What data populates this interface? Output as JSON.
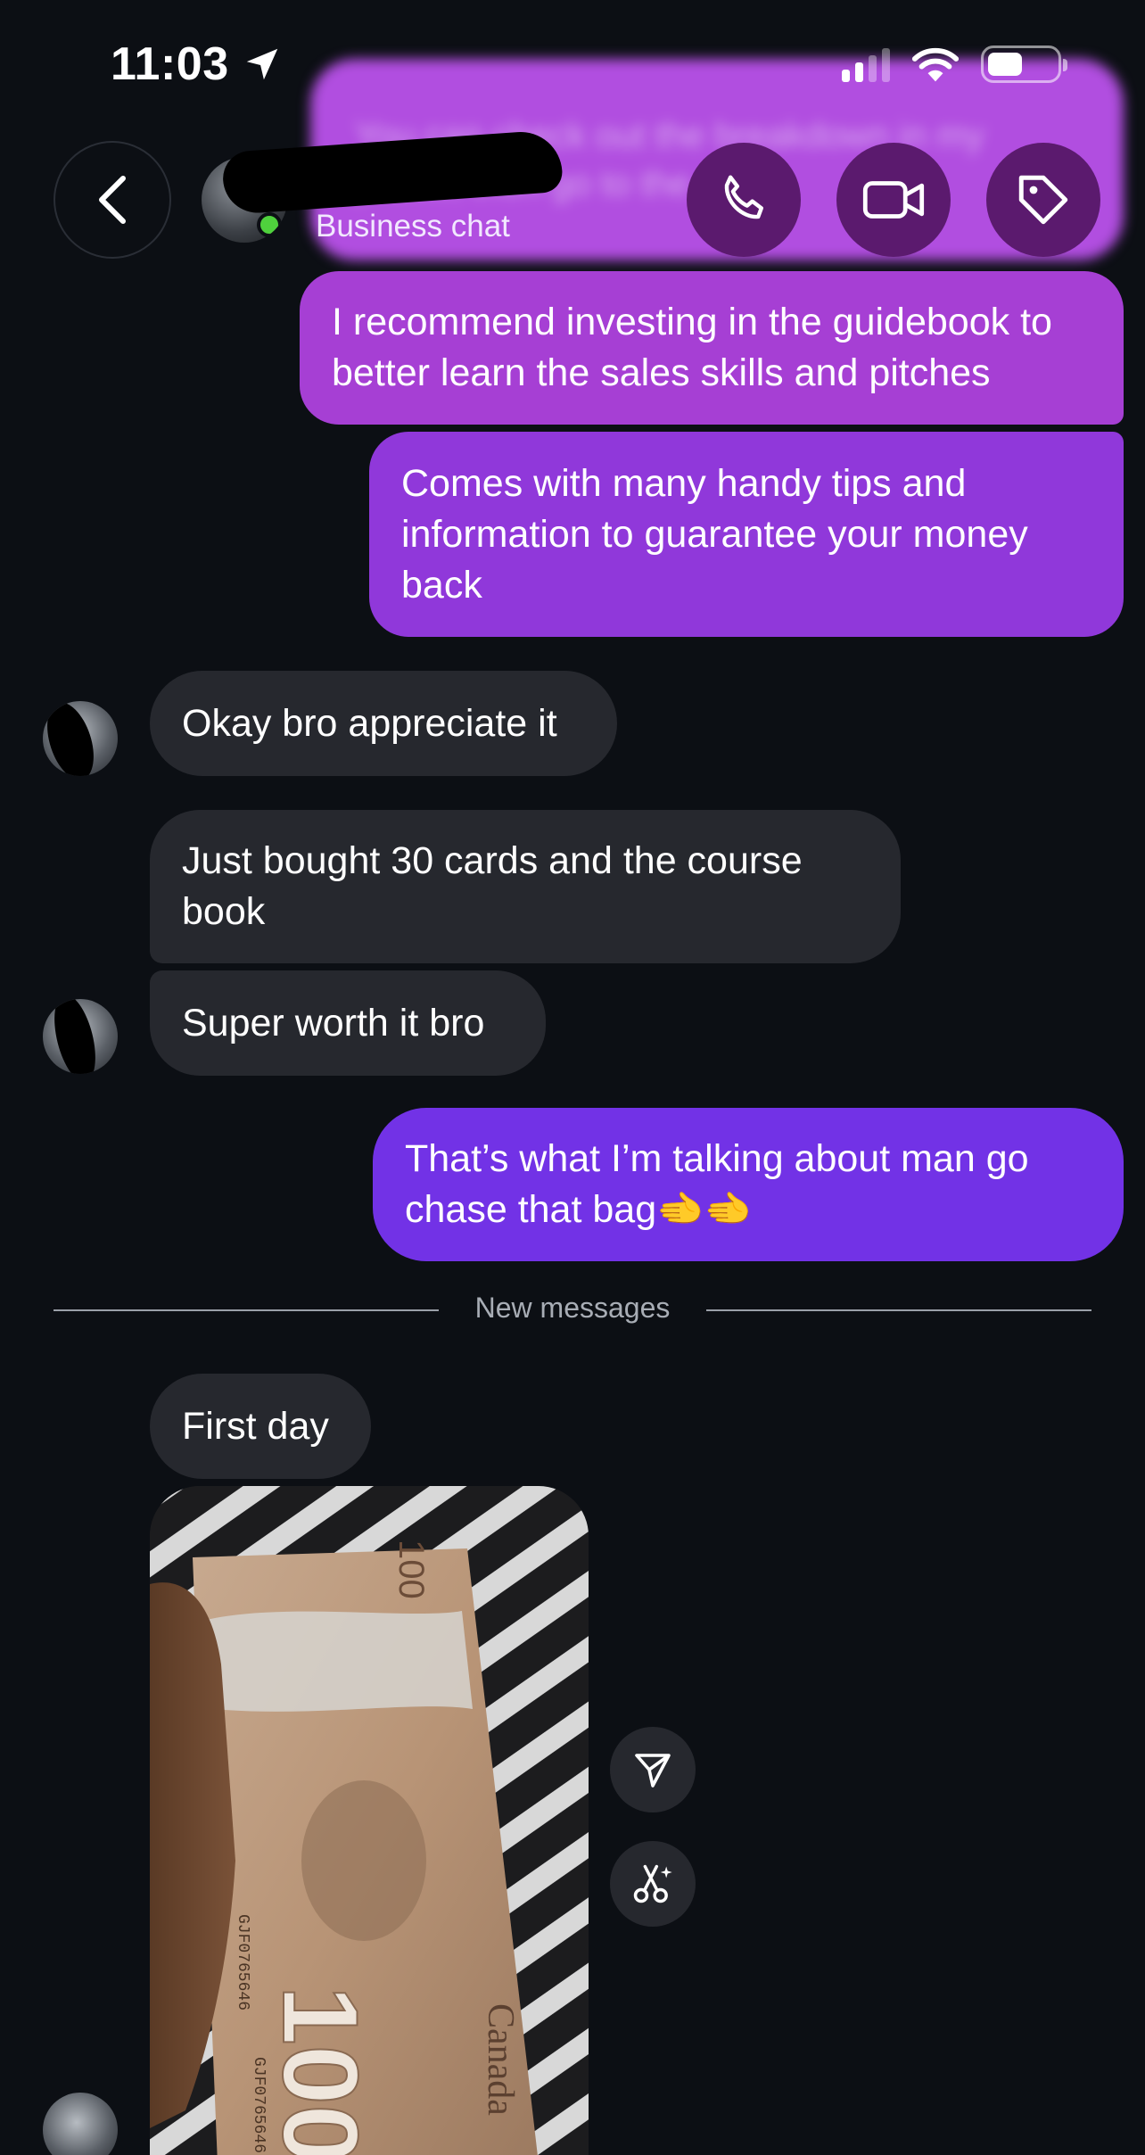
{
  "status_bar": {
    "time": "11:03"
  },
  "header": {
    "subtitle": "Business chat"
  },
  "messages": {
    "blurred_top": "You can check out the breakdown in my profile, then go to the door",
    "m1": "I recommend investing in the guidebook to better learn the sales skills and pitches",
    "m2": "Comes with many handy tips and information to guarantee your money back",
    "m3": "Okay bro appreciate it",
    "m4": "Just bought 30 cards and the course book",
    "m5": "Super worth it bro",
    "m6": "That’s what I’m talking about man go chase that bag🫲🫲",
    "m7": "First day"
  },
  "divider": {
    "label": "New messages"
  },
  "banknote": {
    "denomination": "100",
    "country": "Canada",
    "serial": "GJF0765646"
  },
  "colors": {
    "background": "#0c0f14",
    "outgoing_bubble": "#a63fd4",
    "outgoing_bubble_latest": "#7232e6",
    "incoming_bubble": "#26282e",
    "header_button": "#5b1a6e"
  },
  "icons": {
    "back": "chevron-left-icon",
    "call": "phone-icon",
    "video": "video-camera-icon",
    "label": "tag-icon",
    "share": "send-icon",
    "ai": "scissors-sparkle-icon",
    "location": "location-arrow-icon",
    "signal": "signal-icon",
    "wifi": "wifi-icon",
    "battery": "battery-icon"
  }
}
